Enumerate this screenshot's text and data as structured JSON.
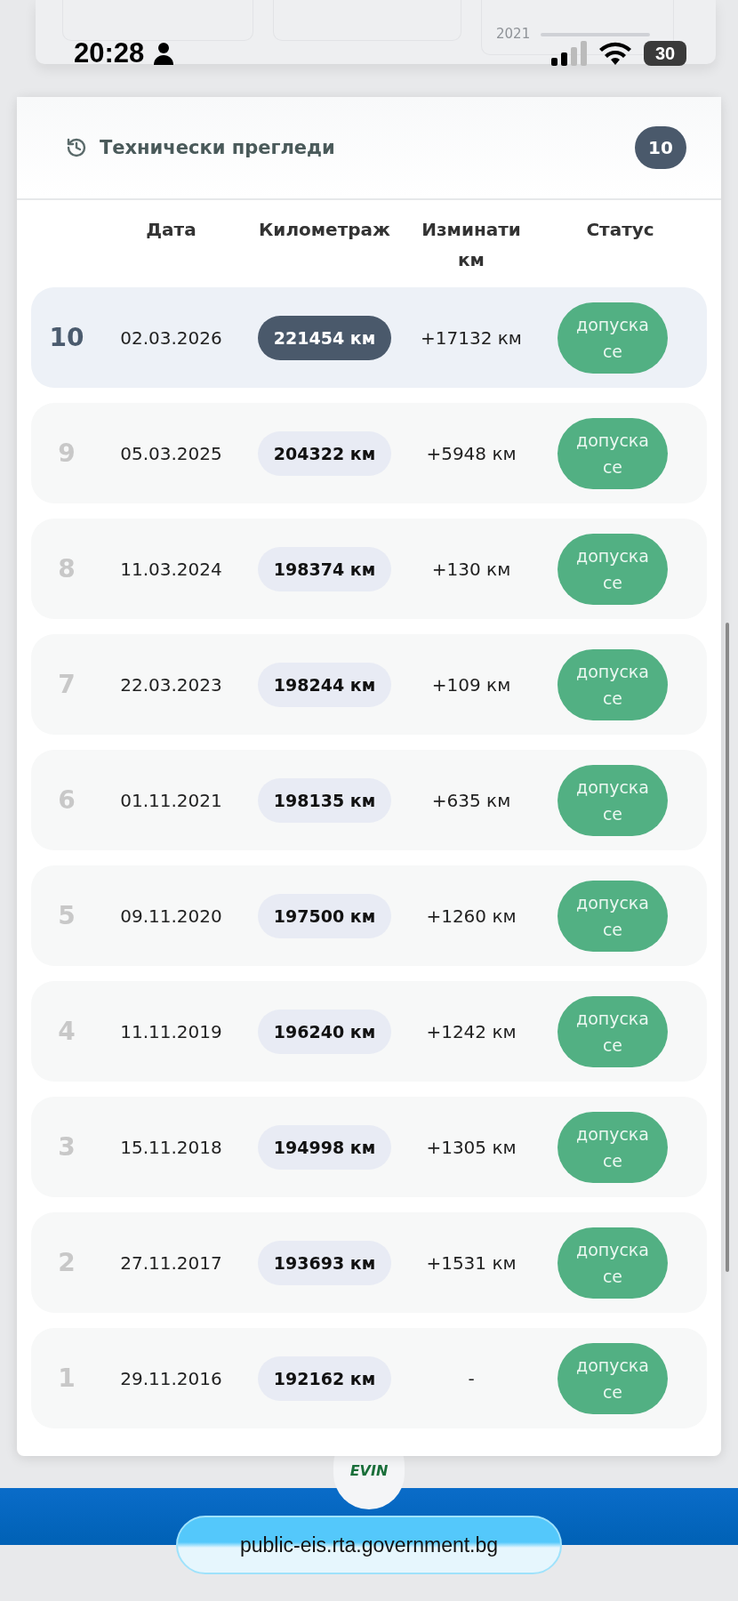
{
  "status_bar": {
    "time": "20:28",
    "battery": "30"
  },
  "background": {
    "year": "2021"
  },
  "panel": {
    "title": "Технически прегледи",
    "count": "10"
  },
  "table": {
    "columns": [
      "Дата",
      "Километраж",
      "Изминати км",
      "Статус"
    ],
    "rows": [
      {
        "index": "10",
        "date": "02.03.2026",
        "mileage": "221454 км",
        "distance": "+17132 км",
        "status": "допуска се",
        "selected": true
      },
      {
        "index": "9",
        "date": "05.03.2025",
        "mileage": "204322 км",
        "distance": "+5948 км",
        "status": "допуска се",
        "selected": false
      },
      {
        "index": "8",
        "date": "11.03.2024",
        "mileage": "198374 км",
        "distance": "+130 км",
        "status": "допуска се",
        "selected": false
      },
      {
        "index": "7",
        "date": "22.03.2023",
        "mileage": "198244 км",
        "distance": "+109 км",
        "status": "допуска се",
        "selected": false
      },
      {
        "index": "6",
        "date": "01.11.2021",
        "mileage": "198135 км",
        "distance": "+635 км",
        "status": "допуска се",
        "selected": false
      },
      {
        "index": "5",
        "date": "09.11.2020",
        "mileage": "197500 км",
        "distance": "+1260 км",
        "status": "допуска се",
        "selected": false
      },
      {
        "index": "4",
        "date": "11.11.2019",
        "mileage": "196240 км",
        "distance": "+1242 км",
        "status": "допуска се",
        "selected": false
      },
      {
        "index": "3",
        "date": "15.11.2018",
        "mileage": "194998 км",
        "distance": "+1305 км",
        "status": "допуска се",
        "selected": false
      },
      {
        "index": "2",
        "date": "27.11.2017",
        "mileage": "193693 км",
        "distance": "+1531 км",
        "status": "допуска се",
        "selected": false
      },
      {
        "index": "1",
        "date": "29.11.2016",
        "mileage": "192162 км",
        "distance": "-",
        "status": "допуска се",
        "selected": false
      }
    ]
  },
  "footer": {
    "logo": "EVIN",
    "url": "public-eis.rta.government.bg"
  }
}
